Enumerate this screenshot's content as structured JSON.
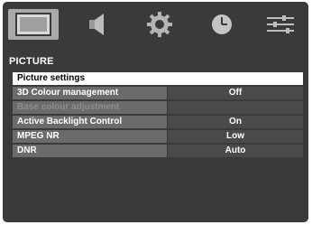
{
  "tabs": [
    {
      "name": "picture",
      "icon": "picture-icon",
      "active": true
    },
    {
      "name": "sound",
      "icon": "speaker-icon",
      "active": false
    },
    {
      "name": "setup",
      "icon": "gear-icon",
      "active": false
    },
    {
      "name": "timer",
      "icon": "clock-icon",
      "active": false
    },
    {
      "name": "options",
      "icon": "options-icon",
      "active": false
    }
  ],
  "section": {
    "title": "PICTURE"
  },
  "menu": {
    "picture_settings": {
      "label": "Picture settings"
    },
    "colour_management": {
      "label": "3D Colour management",
      "value": "Off"
    },
    "base_colour": {
      "label": "Base colour adjustment",
      "value": ""
    },
    "backlight": {
      "label": "Active Backlight Control",
      "value": "On"
    },
    "mpeg_nr": {
      "label": "MPEG NR",
      "value": "Low"
    },
    "dnr": {
      "label": "DNR",
      "value": "Auto"
    }
  },
  "colors": {
    "panel": "#3a3a3a",
    "label_bg": "#6b6b6b",
    "value_bg": "#4a4a4a",
    "selected_bg": "#ffffff",
    "disabled_text": "#8d8d8d"
  }
}
